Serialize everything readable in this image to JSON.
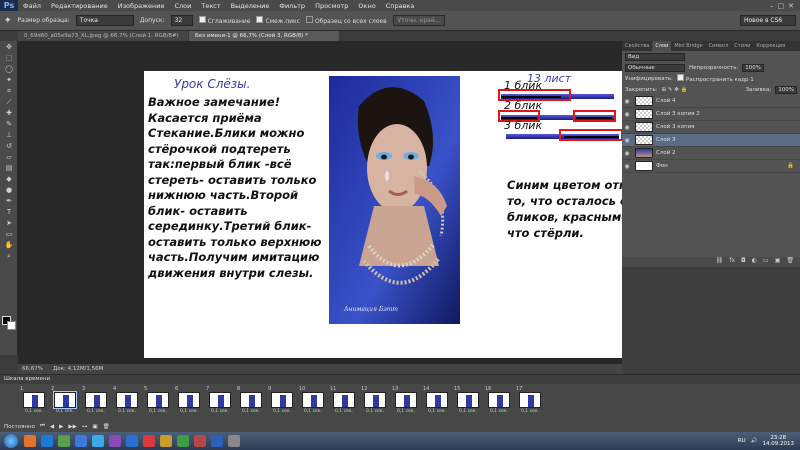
{
  "menubar": {
    "logo": "Ps",
    "items": [
      "Файл",
      "Редактирование",
      "Изображение",
      "Слои",
      "Текст",
      "Выделение",
      "Фильтр",
      "Просмотр",
      "Окно",
      "Справка"
    ],
    "window_controls": [
      "–",
      "□",
      "✕"
    ]
  },
  "options_bar": {
    "sample_size_label": "Размер образца:",
    "sample_size_value": "Точка",
    "tolerance_label": "Допуск:",
    "tolerance_value": "32",
    "antialias_label": "Сглаживание",
    "contiguous_label": "Смеж.пикс",
    "all_layers_label": "Образец со всех слоев",
    "refine_button": "Уточн. край...",
    "workspace_value": "Новое в CS6"
  },
  "document_tabs": [
    "0_69d60_a05e9a73_XL.jpeg @ 66,7% (Слой 1, RGB/8#)",
    "Без имени-1 @ 66,7% (Слой 3, RGB/8) *"
  ],
  "canvas": {
    "lesson_title": "Урок Слёзы.",
    "note_text": "Важное замечание! Касается приёма Стекание.Блики можно стёрочкой подтереть так:первый блик -всё стереть- оставить только нижнюю часть.Второй блик- оставить серединку.Третий блик- оставить только верхнюю часть.Получим имитацию движения внутри слезы.",
    "sheet_number": "13 лист",
    "blik_labels": [
      "1 блик",
      "2 блик",
      "3 блик"
    ],
    "explain_text": "Синим цветом отметила то, что осталось от бликов, красным- то, что стёрли.",
    "portrait_caption": "Анимация Бэтт"
  },
  "status_bar": {
    "zoom": "66,67%",
    "doc_size": "Док: 4,12M/1,56M"
  },
  "panels": {
    "tabs": [
      "Свойства",
      "Слои",
      "Mini Bridge",
      "Символ",
      "Стили",
      "Коррекция"
    ],
    "active_tab": "Слои",
    "search_placeholder": "Вид",
    "blend_mode": "Обычные",
    "opacity_label": "Непрозрачность:",
    "opacity_value": "100%",
    "unify_label": "Унифицировать:",
    "propagate_label": "Распространить кадр 1",
    "lock_label": "Закрепить:",
    "fill_label": "Заливка:",
    "fill_value": "100%",
    "layers": [
      {
        "name": "Слой 4",
        "thumb": "transparent",
        "selected": false
      },
      {
        "name": "Слой 3 копия 2",
        "thumb": "transparent",
        "selected": false
      },
      {
        "name": "Слой 3 копия",
        "thumb": "transparent",
        "selected": false
      },
      {
        "name": "Слой 3",
        "thumb": "transparent",
        "selected": true
      },
      {
        "name": "Слой 2",
        "thumb": "photo",
        "selected": false
      },
      {
        "name": "Фон",
        "thumb": "white",
        "selected": false
      }
    ]
  },
  "timeline": {
    "title": "Шкала времени",
    "frames": [
      {
        "num": "1",
        "delay": "0,1 сек."
      },
      {
        "num": "2",
        "delay": "0,1 сек."
      },
      {
        "num": "3",
        "delay": "0,1 сек."
      },
      {
        "num": "4",
        "delay": "0,1 сек."
      },
      {
        "num": "5",
        "delay": "0,1 сек."
      },
      {
        "num": "6",
        "delay": "0,1 сек."
      },
      {
        "num": "7",
        "delay": "0,1 сек."
      },
      {
        "num": "8",
        "delay": "0,1 сек."
      },
      {
        "num": "9",
        "delay": "0,1 сек."
      },
      {
        "num": "10",
        "delay": "0,1 сек."
      },
      {
        "num": "11",
        "delay": "0,1 сек."
      },
      {
        "num": "12",
        "delay": "0,1 сек."
      },
      {
        "num": "13",
        "delay": "0,1 сек."
      },
      {
        "num": "14",
        "delay": "0,1 сек."
      },
      {
        "num": "15",
        "delay": "0,1 сек."
      },
      {
        "num": "16",
        "delay": "0,1 сек."
      },
      {
        "num": "17",
        "delay": "0,1 сек."
      }
    ],
    "selected_frame": 2,
    "loop_value": "Постоянно"
  },
  "taskbar": {
    "lang": "RU",
    "time": "23:28",
    "date": "14.09.2013",
    "icon_colors": [
      "#e3732b",
      "#1e7bd4",
      "#5aa04a",
      "#3b7ad9",
      "#3da9e8",
      "#8a4ab8",
      "#2b6fd1",
      "#d93b3b",
      "#c89e2b",
      "#3c9c45",
      "#b34848",
      "#2f5fb8",
      "#888888"
    ]
  },
  "colors": {
    "title_blue": "#3a3aa8",
    "highlight_red": "#e01818",
    "bar_blue": "#3434b8",
    "ps_bg": "#535353"
  }
}
